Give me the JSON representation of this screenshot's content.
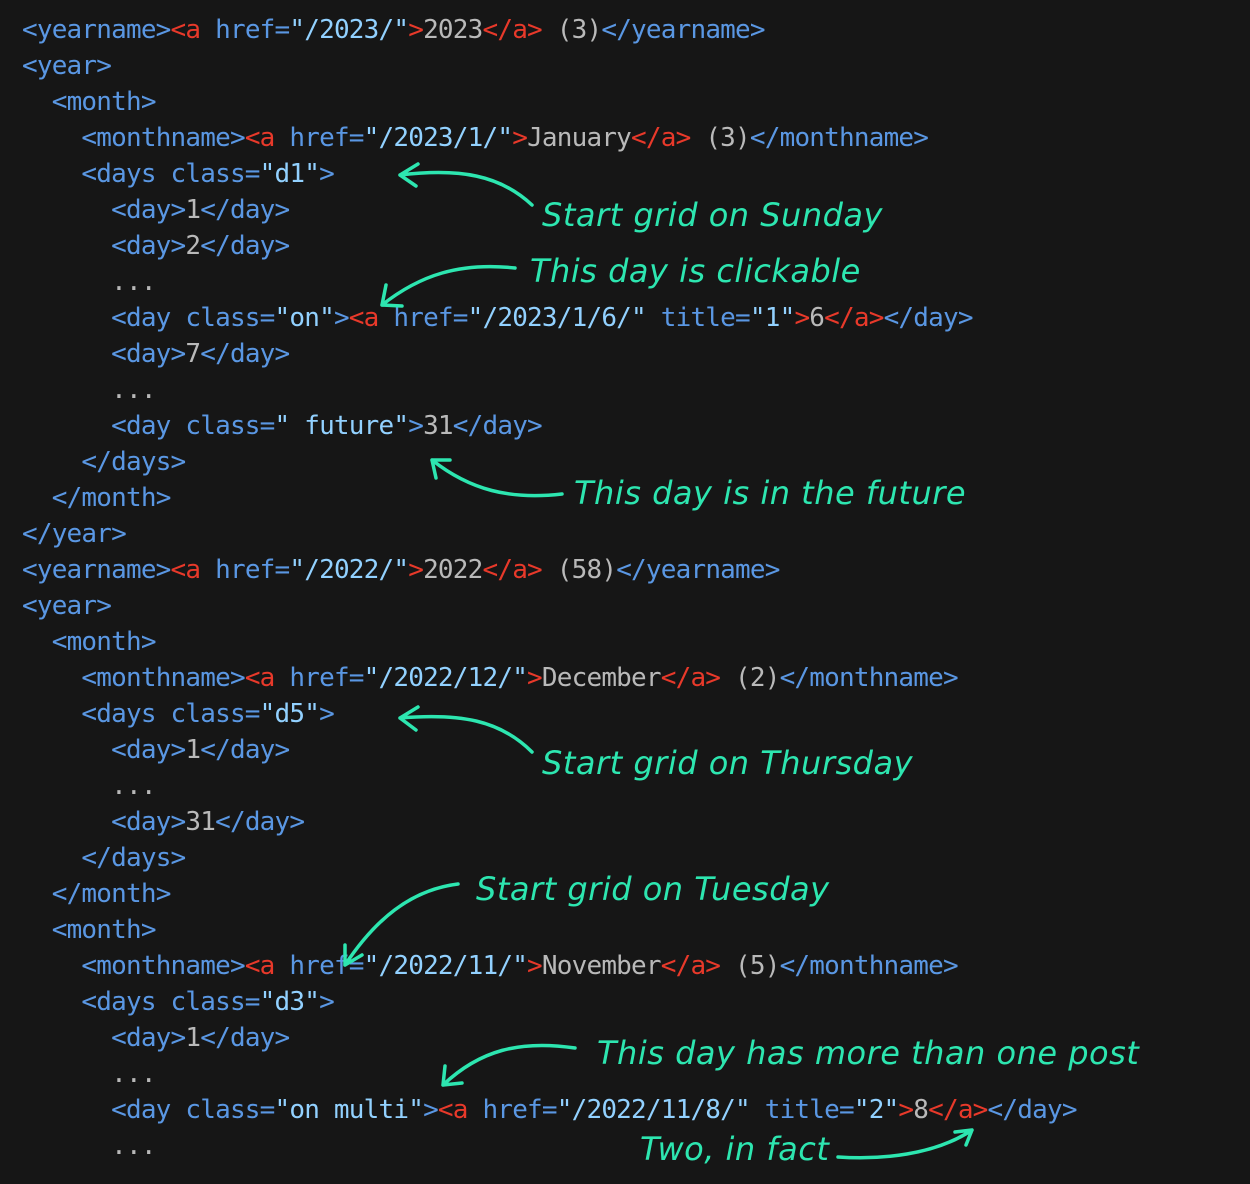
{
  "code_lines": [
    {
      "indent": 0,
      "tokens": [
        [
          "t",
          "<yearname>"
        ],
        [
          "r",
          "<a"
        ],
        [
          "t",
          " href="
        ],
        [
          "v",
          "\"/2023/\""
        ],
        [
          "r",
          ">"
        ],
        [
          "g",
          "2023"
        ],
        [
          "r",
          "</a>"
        ],
        [
          "g",
          " (3)"
        ],
        [
          "t",
          "</yearname>"
        ]
      ]
    },
    {
      "indent": 0,
      "tokens": [
        [
          "t",
          "<year>"
        ]
      ]
    },
    {
      "indent": 1,
      "tokens": [
        [
          "t",
          "<month>"
        ]
      ]
    },
    {
      "indent": 2,
      "tokens": [
        [
          "t",
          "<monthname>"
        ],
        [
          "r",
          "<a"
        ],
        [
          "t",
          " href="
        ],
        [
          "v",
          "\"/2023/1/\""
        ],
        [
          "r",
          ">"
        ],
        [
          "g",
          "January"
        ],
        [
          "r",
          "</a>"
        ],
        [
          "g",
          " (3)"
        ],
        [
          "t",
          "</monthname>"
        ]
      ]
    },
    {
      "indent": 2,
      "tokens": [
        [
          "t",
          "<days class="
        ],
        [
          "v",
          "\"d1\""
        ],
        [
          "t",
          ">"
        ]
      ]
    },
    {
      "indent": 3,
      "tokens": [
        [
          "t",
          "<day>"
        ],
        [
          "g",
          "1"
        ],
        [
          "t",
          "</day>"
        ]
      ]
    },
    {
      "indent": 3,
      "tokens": [
        [
          "t",
          "<day>"
        ],
        [
          "g",
          "2"
        ],
        [
          "t",
          "</day>"
        ]
      ]
    },
    {
      "indent": 3,
      "tokens": [
        [
          "g",
          "..."
        ]
      ]
    },
    {
      "indent": 3,
      "tokens": [
        [
          "t",
          "<day class="
        ],
        [
          "v",
          "\"on\""
        ],
        [
          "t",
          ">"
        ],
        [
          "r",
          "<a"
        ],
        [
          "t",
          " href="
        ],
        [
          "v",
          "\"/2023/1/6/\""
        ],
        [
          "t",
          " title="
        ],
        [
          "v",
          "\"1\""
        ],
        [
          "r",
          ">"
        ],
        [
          "g",
          "6"
        ],
        [
          "r",
          "</a>"
        ],
        [
          "t",
          "</day>"
        ]
      ]
    },
    {
      "indent": 3,
      "tokens": [
        [
          "t",
          "<day>"
        ],
        [
          "g",
          "7"
        ],
        [
          "t",
          "</day>"
        ]
      ]
    },
    {
      "indent": 3,
      "tokens": [
        [
          "g",
          "..."
        ]
      ]
    },
    {
      "indent": 3,
      "tokens": [
        [
          "t",
          "<day class="
        ],
        [
          "v",
          "\" future\""
        ],
        [
          "t",
          ">"
        ],
        [
          "g",
          "31"
        ],
        [
          "t",
          "</day>"
        ]
      ]
    },
    {
      "indent": 2,
      "tokens": [
        [
          "t",
          "</days>"
        ]
      ]
    },
    {
      "indent": 1,
      "tokens": [
        [
          "t",
          "</month>"
        ]
      ]
    },
    {
      "indent": 0,
      "tokens": [
        [
          "t",
          "</year>"
        ]
      ]
    },
    {
      "indent": 0,
      "tokens": [
        [
          "t",
          "<yearname>"
        ],
        [
          "r",
          "<a"
        ],
        [
          "t",
          " href="
        ],
        [
          "v",
          "\"/2022/\""
        ],
        [
          "r",
          ">"
        ],
        [
          "g",
          "2022"
        ],
        [
          "r",
          "</a>"
        ],
        [
          "g",
          " (58)"
        ],
        [
          "t",
          "</yearname>"
        ]
      ]
    },
    {
      "indent": 0,
      "tokens": [
        [
          "t",
          "<year>"
        ]
      ]
    },
    {
      "indent": 1,
      "tokens": [
        [
          "t",
          "<month>"
        ]
      ]
    },
    {
      "indent": 2,
      "tokens": [
        [
          "t",
          "<monthname>"
        ],
        [
          "r",
          "<a"
        ],
        [
          "t",
          " href="
        ],
        [
          "v",
          "\"/2022/12/\""
        ],
        [
          "r",
          ">"
        ],
        [
          "g",
          "December"
        ],
        [
          "r",
          "</a>"
        ],
        [
          "g",
          " (2)"
        ],
        [
          "t",
          "</monthname>"
        ]
      ]
    },
    {
      "indent": 2,
      "tokens": [
        [
          "t",
          "<days class="
        ],
        [
          "v",
          "\"d5\""
        ],
        [
          "t",
          ">"
        ]
      ]
    },
    {
      "indent": 3,
      "tokens": [
        [
          "t",
          "<day>"
        ],
        [
          "g",
          "1"
        ],
        [
          "t",
          "</day>"
        ]
      ]
    },
    {
      "indent": 3,
      "tokens": [
        [
          "g",
          "..."
        ]
      ]
    },
    {
      "indent": 3,
      "tokens": [
        [
          "t",
          "<day>"
        ],
        [
          "g",
          "31"
        ],
        [
          "t",
          "</day>"
        ]
      ]
    },
    {
      "indent": 2,
      "tokens": [
        [
          "t",
          "</days>"
        ]
      ]
    },
    {
      "indent": 1,
      "tokens": [
        [
          "t",
          "</month>"
        ]
      ]
    },
    {
      "indent": 1,
      "tokens": [
        [
          "t",
          "<month>"
        ]
      ]
    },
    {
      "indent": 2,
      "tokens": [
        [
          "t",
          "<monthname>"
        ],
        [
          "r",
          "<a"
        ],
        [
          "t",
          " href="
        ],
        [
          "v",
          "\"/2022/11/\""
        ],
        [
          "r",
          ">"
        ],
        [
          "g",
          "November"
        ],
        [
          "r",
          "</a>"
        ],
        [
          "g",
          " (5)"
        ],
        [
          "t",
          "</monthname>"
        ]
      ]
    },
    {
      "indent": 2,
      "tokens": [
        [
          "t",
          "<days class="
        ],
        [
          "v",
          "\"d3\""
        ],
        [
          "t",
          ">"
        ]
      ]
    },
    {
      "indent": 3,
      "tokens": [
        [
          "t",
          "<day>"
        ],
        [
          "g",
          "1"
        ],
        [
          "t",
          "</day>"
        ]
      ]
    },
    {
      "indent": 3,
      "tokens": [
        [
          "g",
          "..."
        ]
      ]
    },
    {
      "indent": 3,
      "tokens": [
        [
          "t",
          "<day class="
        ],
        [
          "v",
          "\"on multi\""
        ],
        [
          "t",
          ">"
        ],
        [
          "r",
          "<a"
        ],
        [
          "t",
          " href="
        ],
        [
          "v",
          "\"/2022/11/8/\""
        ],
        [
          "t",
          " title="
        ],
        [
          "v",
          "\"2\""
        ],
        [
          "r",
          ">"
        ],
        [
          "g",
          "8"
        ],
        [
          "r",
          "</a>"
        ],
        [
          "t",
          "</day>"
        ]
      ]
    },
    {
      "indent": 3,
      "tokens": [
        [
          "g",
          "..."
        ]
      ]
    }
  ],
  "annotations": {
    "sunday": "Start grid on Sunday",
    "clickable": "This day is clickable",
    "future": "This day is in the future",
    "thursday": "Start grid on Thursday",
    "tuesday": "Start grid on Tuesday",
    "multi": "This day has more than one post",
    "two": "Two, in fact"
  },
  "colors": {
    "background": "#161616",
    "tag": "#5a97e3",
    "value": "#92d1ff",
    "anchor": "#e8392a",
    "text": "#b9b9b9",
    "annotation": "#2de6b0"
  }
}
